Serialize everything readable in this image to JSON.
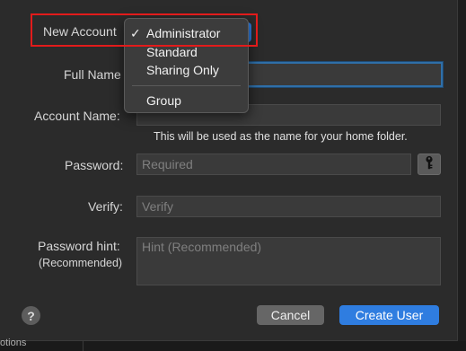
{
  "form": {
    "new_account_label": "New Account",
    "full_name_label": "Full Name",
    "full_name_value": "",
    "account_name_label": "Account Name:",
    "account_name_value": "",
    "account_name_hint": "This will be used as the name for your home folder.",
    "password_label": "Password:",
    "password_placeholder": "Required",
    "verify_label": "Verify:",
    "verify_placeholder": "Verify",
    "hint_label": "Password hint:",
    "hint_sublabel": "(Recommended)",
    "hint_placeholder": "Hint (Recommended)"
  },
  "popup_menu": {
    "selected": "Administrator",
    "check_glyph": "✓",
    "items": [
      {
        "label": "Administrator",
        "checked": true
      },
      {
        "label": "Standard",
        "checked": false
      },
      {
        "label": "Sharing Only",
        "checked": false
      },
      {
        "label": "Group",
        "checked": false
      }
    ]
  },
  "buttons": {
    "help_label": "?",
    "cancel_label": "Cancel",
    "create_label": "Create User"
  },
  "icons": {
    "password_assistant": "key-icon",
    "help": "question-icon"
  },
  "background": {
    "bottom_fragment": "otions"
  },
  "colors": {
    "accent": "#2f7de0",
    "highlight_box": "#e21b1b",
    "sheet_bg": "#2b2b2b"
  }
}
